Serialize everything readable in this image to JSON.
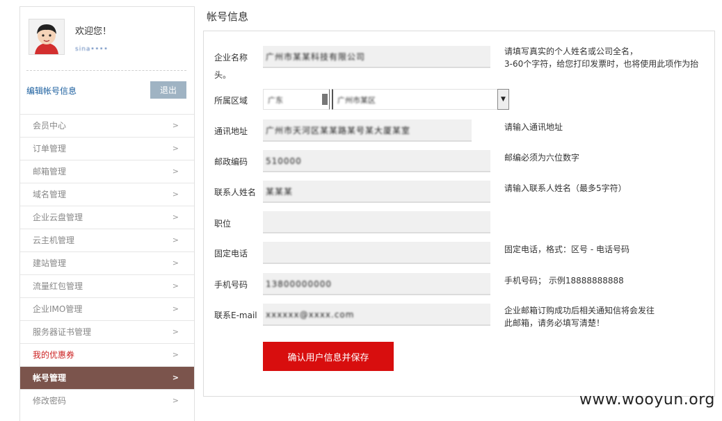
{
  "sidebar": {
    "welcome": "欢迎您！",
    "username": "sina••••",
    "edit_link": "编辑帐号信息",
    "logout": "退出",
    "items": [
      {
        "label": "会员中心",
        "chev": ">"
      },
      {
        "label": "订单管理",
        "chev": ">"
      },
      {
        "label": "邮箱管理",
        "chev": ">"
      },
      {
        "label": "域名管理",
        "chev": ">"
      },
      {
        "label": "企业云盘管理",
        "chev": ">"
      },
      {
        "label": "云主机管理",
        "chev": ">"
      },
      {
        "label": "建站管理",
        "chev": ">"
      },
      {
        "label": "流量红包管理",
        "chev": ">"
      },
      {
        "label": "企业IMO管理",
        "chev": ">"
      },
      {
        "label": "服务器证书管理",
        "chev": ">"
      },
      {
        "label": "我的优惠券",
        "chev": ">"
      },
      {
        "label": "帐号管理",
        "chev": ">"
      },
      {
        "label": "修改密码",
        "chev": ">"
      }
    ]
  },
  "main": {
    "title": "帐号信息",
    "company": {
      "label1": "企业名称",
      "label2": "头。",
      "value": "广州市某某科技有限公司",
      "hint1": "请填写真实的个人姓名或公司全名，",
      "hint2": "3-60个字符，给您打印发票时，也将使用此项作为抬"
    },
    "region": {
      "label": "所属区域",
      "province": "广东",
      "city": "广州市某区"
    },
    "address": {
      "label": "通讯地址",
      "value": "广州市天河区某某路某号某大厦某室",
      "hint": "请输入通讯地址"
    },
    "postcode": {
      "label": "邮政编码",
      "value": "510000",
      "hint": "邮编必须为六位数字"
    },
    "contact": {
      "label": "联系人姓名",
      "value": "某某某",
      "hint": "请输入联系人姓名（最多5字符）"
    },
    "position": {
      "label": "职位",
      "value": ""
    },
    "phone": {
      "label": "固定电话",
      "value": "",
      "hint": "固定电话，格式：区号 - 电话号码"
    },
    "mobile": {
      "label": "手机号码",
      "value": "13800000000",
      "hint": "手机号码； 示例18888888888"
    },
    "email": {
      "label": "联系E-mail",
      "value": "xxxxxx@xxxx.com",
      "hint1": "企业邮箱订购成功后相关通知信将会发往",
      "hint2": "此邮箱，请务必填写清楚！"
    },
    "submit": "确认用户信息并保存"
  },
  "watermark": "www.wooyun.org",
  "colors": {
    "active_menu": "#7b544c",
    "promo_text": "#cc2222",
    "submit": "#d80e0e",
    "logout": "#9fb3c3",
    "link": "#1a5e9e"
  }
}
